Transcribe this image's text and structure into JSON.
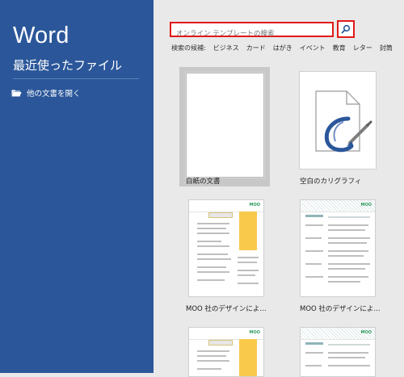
{
  "sidebar": {
    "app_title": "Word",
    "recent_heading": "最近使ったファイル",
    "open_other": "他の文書を開く",
    "bg_color": "#2b579a"
  },
  "search": {
    "placeholder": "オンライン テンプレートの検索",
    "button_icon": "search-icon",
    "highlight_color": "#e21818"
  },
  "suggestions": {
    "label": "検索の候補:",
    "items": [
      "ビジネス",
      "カード",
      "はがき",
      "イベント",
      "教育",
      "レター",
      "封筒"
    ]
  },
  "templates": [
    {
      "label": "白紙の文書"
    },
    {
      "label": "空白のカリグラフィ"
    },
    {
      "label": "MOO 社のデザインによ..."
    },
    {
      "label": "MOO 社のデザインによ..."
    }
  ],
  "moo": {
    "logo": "MOO"
  }
}
